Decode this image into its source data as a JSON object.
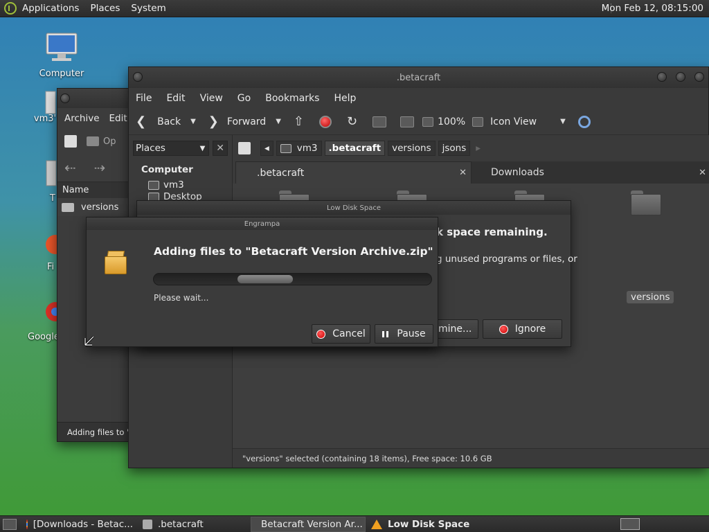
{
  "top_panel": {
    "menus": [
      "Applications",
      "Places",
      "System"
    ],
    "clock": "Mon Feb 12, 08:15:00"
  },
  "desktop": {
    "icons": [
      {
        "label": "Computer"
      },
      {
        "label": "vm3'"
      },
      {
        "label": "T"
      },
      {
        "label": "Fi"
      },
      {
        "label": "Google"
      }
    ]
  },
  "archive_window": {
    "menus": [
      "Archive",
      "Edit"
    ],
    "toolbar_partial": "Op",
    "column_name": "Name",
    "row": "versions",
    "status": "Adding files to \"Be"
  },
  "caja": {
    "title": ".betacraft",
    "menus": [
      "File",
      "Edit",
      "View",
      "Go",
      "Bookmarks",
      "Help"
    ],
    "toolbar": {
      "back": "Back",
      "forward": "Forward",
      "zoom": "100%",
      "view_mode": "Icon View"
    },
    "sidebar": {
      "selector": "Places",
      "heading": "Computer",
      "items": [
        "vm3",
        "Desktop"
      ]
    },
    "pathbar": [
      "vm3",
      ".betacraft",
      "versions",
      "jsons"
    ],
    "tabs": [
      ".betacraft",
      "Downloads"
    ],
    "selected_folder": "versions",
    "status": "\"versions\" selected (containing 18 items), Free space: 10.6 GB"
  },
  "low_disk": {
    "title": "Low Disk Space",
    "heading": "k space remaining.",
    "text": "g unused programs or files, or",
    "examine_label": "mine...",
    "ignore_label": "Ignore"
  },
  "engrampa_dialog": {
    "title": "Engrampa",
    "heading": "Adding files to \"Betacraft Version Archive.zip\"",
    "subtext": "Please wait...",
    "progress": 0.3,
    "cancel_label": "Cancel",
    "pause_label": "Pause"
  },
  "taskbar": {
    "items": [
      "[Downloads - Betac...",
      ".betacraft",
      "Betacraft Version Ar...",
      "Low Disk Space"
    ]
  }
}
